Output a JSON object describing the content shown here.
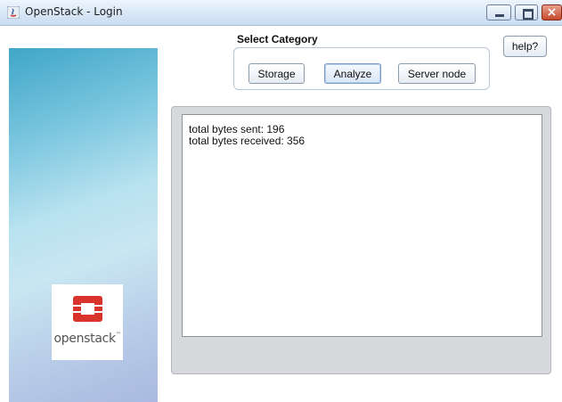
{
  "window": {
    "title": "OpenStack - Login",
    "controls": {
      "minimize": "",
      "maximize": "",
      "close": "×"
    }
  },
  "banner": {
    "logo_text": "openstack",
    "logo_tm": "™",
    "colors": {
      "logo_red": "#d9342b",
      "banner_blue": "#3fa6c7"
    }
  },
  "category": {
    "label": "Select Category",
    "buttons": {
      "storage": "Storage",
      "analyze": "Analyze",
      "server_node": "Server node"
    }
  },
  "help_button": "help?",
  "output": {
    "lines": [
      "total bytes sent: 196",
      "total bytes received: 356"
    ]
  }
}
